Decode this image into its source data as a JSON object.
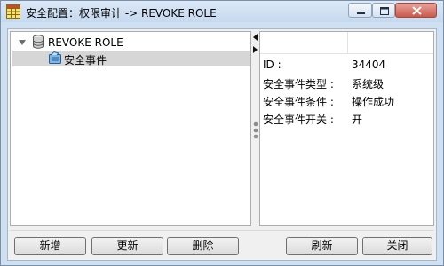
{
  "window": {
    "title": "安全配置：权限审计 -> REVOKE ROLE",
    "controls": [
      "minimize-icon",
      "maximize-icon",
      "close-icon"
    ]
  },
  "tree": {
    "root": {
      "label": "REVOKE ROLE",
      "icon": "database-icon",
      "expanded": true
    },
    "children": [
      {
        "label": "安全事件",
        "icon": "security-event-icon",
        "selected": true
      }
    ]
  },
  "properties": [
    {
      "key": "ID :",
      "value": "34404"
    },
    {
      "key": "安全事件类型 :",
      "value": "系统级"
    },
    {
      "key": "安全事件条件 :",
      "value": "操作成功"
    },
    {
      "key": "安全事件开关 :",
      "value": "开"
    }
  ],
  "buttons": {
    "add": "新增",
    "update": "更新",
    "delete": "删除",
    "refresh": "刷新",
    "close": "关闭"
  },
  "colors": {
    "title_gradient_top": "#dbe8f7",
    "selected_row": "#d6d6d6",
    "close_button": "#c75a4c"
  }
}
